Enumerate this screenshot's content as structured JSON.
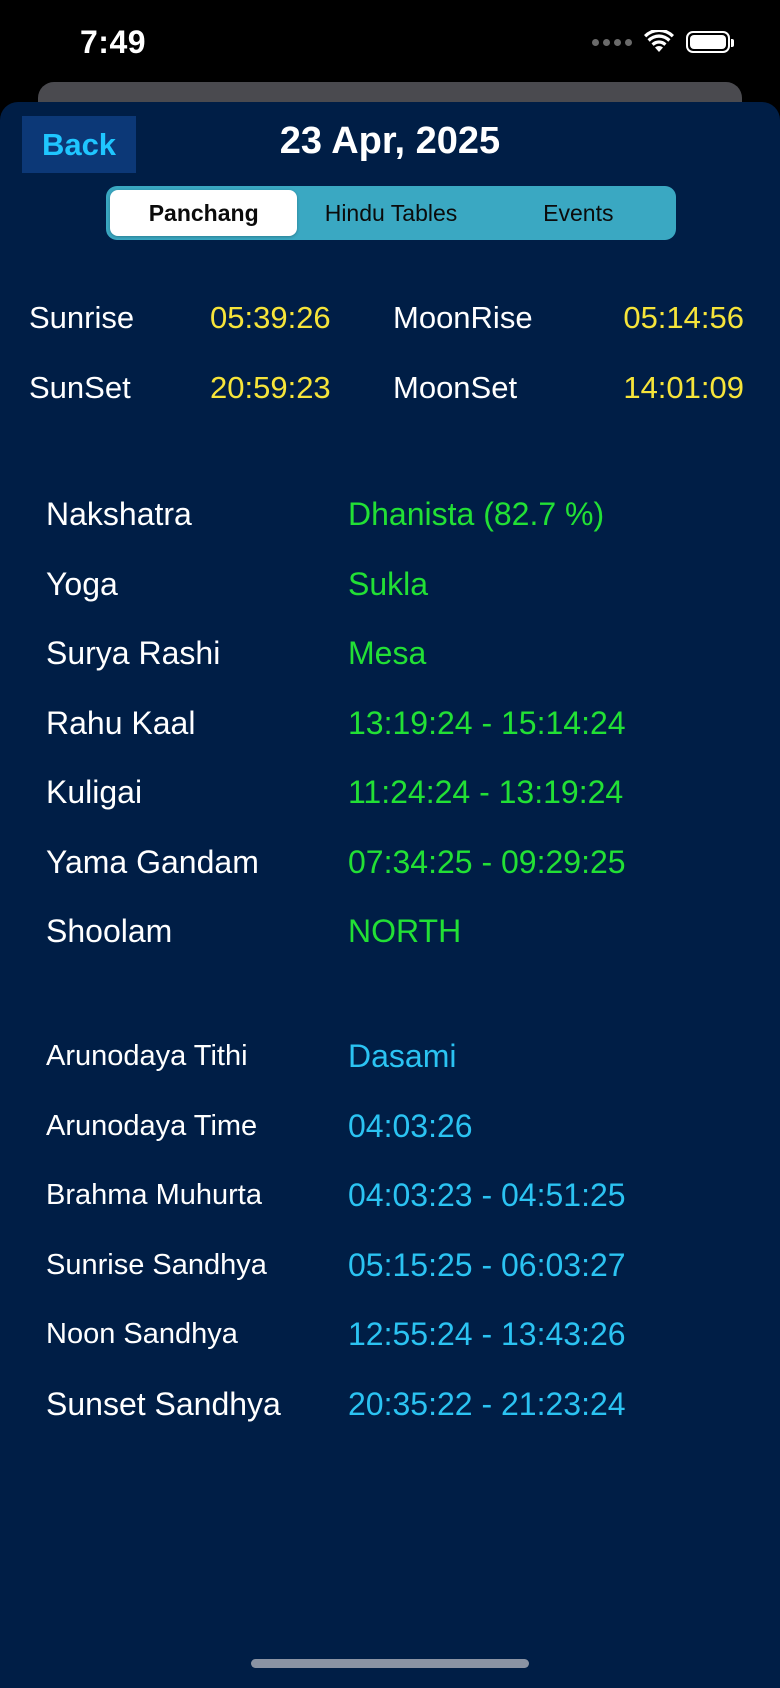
{
  "status": {
    "time": "7:49"
  },
  "header": {
    "back_label": "Back",
    "date": "23 Apr, 2025"
  },
  "tabs": [
    {
      "label": "Panchang",
      "active": true
    },
    {
      "label": "Hindu Tables",
      "active": false
    },
    {
      "label": "Events",
      "active": false
    }
  ],
  "sun_moon": {
    "sunrise": {
      "label": "Sunrise",
      "value": "05:39:26"
    },
    "sunset": {
      "label": "SunSet",
      "value": "20:59:23"
    },
    "moonrise": {
      "label": "MoonRise",
      "value": "05:14:56"
    },
    "moonset": {
      "label": "MoonSet",
      "value": "14:01:09"
    }
  },
  "details": [
    {
      "label": "Nakshatra",
      "value": "Dhanista (82.7 %)"
    },
    {
      "label": "Yoga",
      "value": "Sukla"
    },
    {
      "label": "Surya Rashi",
      "value": "Mesa"
    },
    {
      "label": "Rahu Kaal",
      "value": "13:19:24 - 15:14:24"
    },
    {
      "label": "Kuligai",
      "value": "11:24:24 - 13:19:24"
    },
    {
      "label": "Yama Gandam",
      "value": "07:34:25 - 09:29:25"
    },
    {
      "label": "Shoolam",
      "value": "NORTH"
    }
  ],
  "timings": [
    {
      "label": "Arunodaya Tithi",
      "value": "Dasami"
    },
    {
      "label": "Arunodaya Time",
      "value": "04:03:26"
    },
    {
      "label": "Brahma Muhurta",
      "value": "04:03:23 - 04:51:25"
    },
    {
      "label": "Sunrise Sandhya",
      "value": "05:15:25 - 06:03:27"
    },
    {
      "label": "Noon Sandhya",
      "value": "12:55:24 - 13:43:26"
    },
    {
      "label": "Sunset Sandhya",
      "value": "20:35:22 - 21:23:24"
    }
  ],
  "colors": {
    "background": "#001e46",
    "time_value": "#f6e43a",
    "detail_value": "#22e035",
    "timing_value": "#2bc3f2",
    "tab_bar": "#3aa8c2"
  },
  "icons": [
    "wifi-icon",
    "battery-icon",
    "cellular-signal-icon"
  ]
}
